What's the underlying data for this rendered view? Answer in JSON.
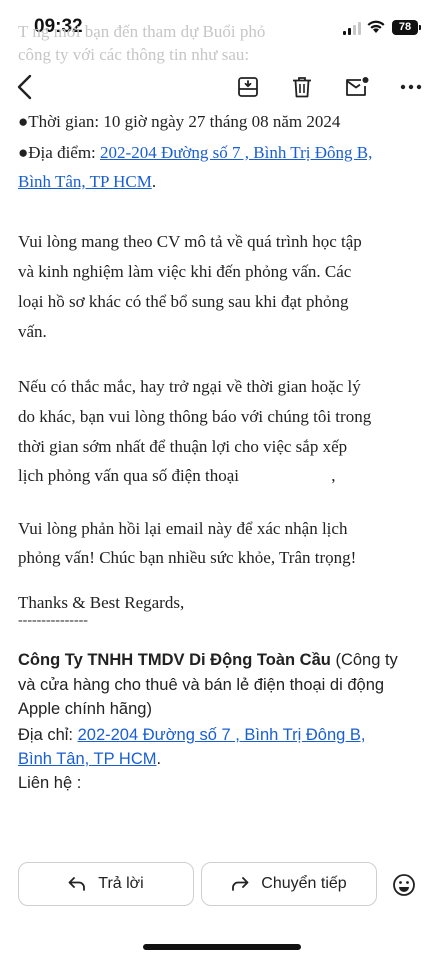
{
  "status_bar": {
    "time": "09:32",
    "battery": "78"
  },
  "toolbar": {
    "ghost_line_1": "T  ng  mời bạn đến tham dự Buổi phỏ  ",
    "ghost_line_2": "công ty với các thông tin như sau:",
    "icons": [
      "back-icon",
      "archive-icon",
      "trash-icon",
      "mark-unread-icon",
      "more-icon"
    ]
  },
  "email": {
    "cut_line": "●Thời gian: 10 giờ ngày 27 tháng 08 năm 2024",
    "location_label": "●Địa điểm: ",
    "location_link_1": "202-204 Đường số 7 , Bình Trị Đông B,",
    "location_link_2": "Bình Tân, TP HCM",
    "location_period": ".",
    "para1_line1": "Vui lòng mang theo CV mô tả về quá trình học tập",
    "para1_line2": "và kinh nghiệm làm việc khi đến phỏng vấn. Các",
    "para1_line3": "loại hồ sơ khác có thể bổ sung sau khi đạt phỏng",
    "para1_line4": "vấn.",
    "para2_line1": "Nếu có thắc mắc, hay trở ngại về thời gian hoặc lý",
    "para2_line2": "do khác, bạn vui lòng thông báo với chúng tôi trong",
    "para2_line3": "thời gian sớm nhất để thuận lợi cho việc sắp xếp",
    "para2_line4": "lịch phỏng vấn qua số điện thoại",
    "para2_tail": ",",
    "para3_line1": "Vui lòng phản hồi lại email này để xác nhận lịch",
    "para3_line2": "phỏng vấn! Chúc bạn nhiều sức khỏe, Trân trọng!",
    "thanks": "Thanks & Best Regards,",
    "dashes": "---------------",
    "company_name": "Công Ty TNHH TMDV Di Động Toàn Cầu",
    "company_desc_1": " (Công ty",
    "company_desc_2": "và cửa hàng cho thuê và bán lẻ điện thoại di động",
    "company_desc_3": "Apple chính hãng)",
    "address_label": "Địa chỉ: ",
    "address_link_1": "202-204 Đường số 7 , Bình Trị Đông B,",
    "address_link_2": "Bình Tân, TP HCM",
    "address_period": ".",
    "contact_label": "Liên hệ : "
  },
  "actions": {
    "reply_label": "Trả lời",
    "forward_label": "Chuyển tiếp"
  }
}
